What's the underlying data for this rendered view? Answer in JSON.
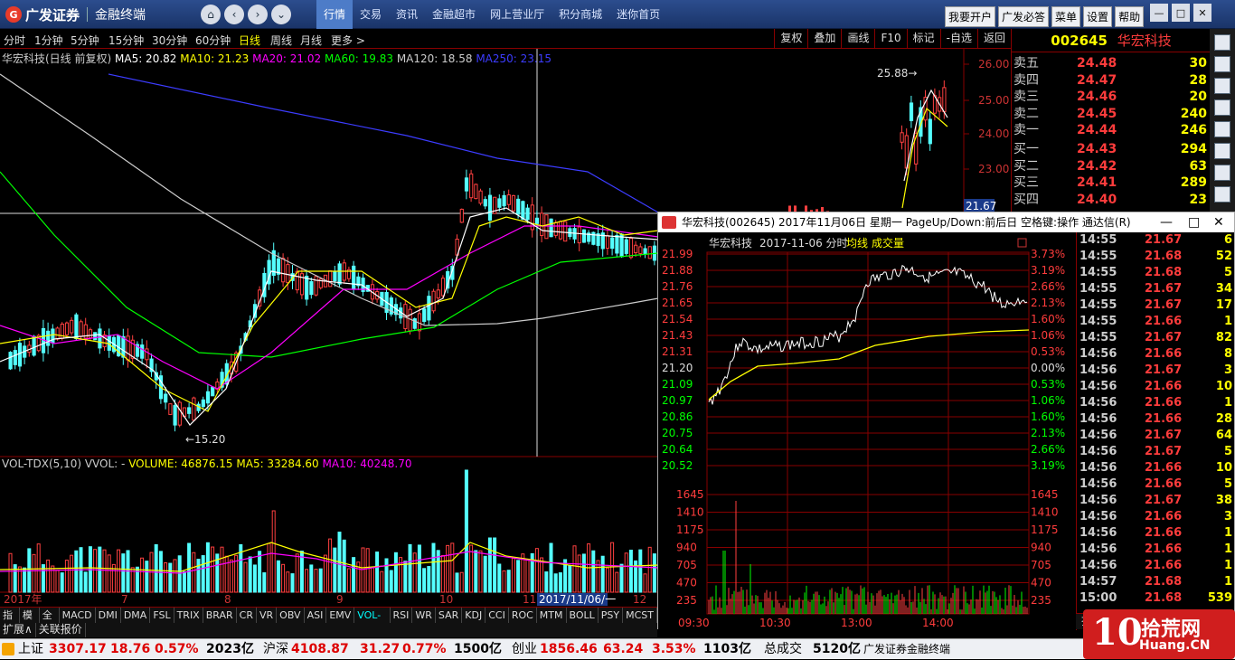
{
  "titlebar": {
    "logo_text": "广发证券",
    "logo_subtitle": "金融终端",
    "menu": [
      "行情",
      "交易",
      "资讯",
      "金融超市",
      "网上营业厅",
      "积分商城",
      "迷你首页"
    ],
    "active_menu": "行情",
    "right_buttons": [
      "我要开户",
      "广发必答",
      "菜单",
      "设置",
      "帮助"
    ]
  },
  "period_bar": {
    "periods": [
      "分时",
      "1分钟",
      "5分钟",
      "15分钟",
      "30分钟",
      "60分钟",
      "日线",
      "周线",
      "月线",
      "更多 >"
    ],
    "active": "日线",
    "tools": [
      "复权",
      "叠加",
      "画线",
      "F10",
      "标记",
      "-自选",
      "返回"
    ]
  },
  "ma_legend": {
    "prefix": "华宏科技(日线 前复权)",
    "items": [
      {
        "label": "MA5: 20.82",
        "color": "#ffffff"
      },
      {
        "label": "MA10: 21.23",
        "color": "#ffff00"
      },
      {
        "label": "MA20: 21.02",
        "color": "#ff00ff"
      },
      {
        "label": "MA60: 19.83",
        "color": "#00ff00"
      },
      {
        "label": "MA120: 18.58",
        "color": "#cccccc"
      },
      {
        "label": "MA250: 23.15",
        "color": "#3c3cff"
      }
    ]
  },
  "vol_legend": {
    "prefix": "VOL-TDX(5,10)  VVOL: -",
    "items": [
      {
        "label": "VOLUME: 46876.15",
        "color": "#ffff00"
      },
      {
        "label": "MA5: 33284.60",
        "color": "#ffff00"
      },
      {
        "label": "MA10: 40248.70",
        "color": "#ff00ff"
      }
    ]
  },
  "kline_axis": {
    "price_ticks": [
      "26.00",
      "25.00",
      "24.00",
      "23.00"
    ],
    "cursor_price": "21.67",
    "low_label": "15.20",
    "high_label": "25.88",
    "date_labels": [
      "2017年",
      "7",
      "8",
      "9",
      "10",
      "11",
      "2017/11/06/一",
      "12"
    ]
  },
  "quote": {
    "code": "002645",
    "name": "华宏科技",
    "rows": [
      {
        "label": "卖五",
        "price": "24.48",
        "vol": "30"
      },
      {
        "label": "卖四",
        "price": "24.47",
        "vol": "28"
      },
      {
        "label": "卖三",
        "price": "24.46",
        "vol": "20"
      },
      {
        "label": "卖二",
        "price": "24.45",
        "vol": "240"
      },
      {
        "label": "卖一",
        "price": "24.44",
        "vol": "246"
      },
      {
        "label": "买一",
        "price": "24.43",
        "vol": "294"
      },
      {
        "label": "买二",
        "price": "24.42",
        "vol": "63"
      },
      {
        "label": "买三",
        "price": "24.41",
        "vol": "289"
      },
      {
        "label": "买四",
        "price": "24.40",
        "vol": "23"
      }
    ]
  },
  "popup": {
    "title": "华宏科技(002645)  2017年11月06日  星期一  PageUp/Down:前后日  空格键:操作  通达信(R)",
    "chart_header": [
      "华宏科技",
      "2017-11-06 分时",
      "均线",
      "成交量"
    ],
    "price_ticks": [
      "21.99",
      "21.88",
      "21.76",
      "21.65",
      "21.54",
      "21.43",
      "21.31",
      "21.20",
      "21.09",
      "20.97",
      "20.86",
      "20.75",
      "20.64",
      "20.52"
    ],
    "pct_ticks": [
      "3.73%",
      "3.19%",
      "2.66%",
      "2.13%",
      "1.60%",
      "1.06%",
      "0.53%",
      "0.00%",
      "0.53%",
      "1.06%",
      "1.60%",
      "2.13%",
      "2.66%",
      "3.19%"
    ],
    "vol_ticks": [
      "1645",
      "1410",
      "1175",
      "940",
      "705",
      "470",
      "235"
    ],
    "time_labels": [
      "09:30",
      "10:30",
      "13:00",
      "14:00"
    ],
    "bottom_tab": "操作",
    "ticks": [
      {
        "t": "14:55",
        "p": "21.67",
        "v": "6"
      },
      {
        "t": "14:55",
        "p": "21.68",
        "v": "52"
      },
      {
        "t": "14:55",
        "p": "21.68",
        "v": "5"
      },
      {
        "t": "14:55",
        "p": "21.67",
        "v": "34"
      },
      {
        "t": "14:55",
        "p": "21.67",
        "v": "17"
      },
      {
        "t": "14:55",
        "p": "21.66",
        "v": "1"
      },
      {
        "t": "14:55",
        "p": "21.67",
        "v": "82"
      },
      {
        "t": "14:56",
        "p": "21.66",
        "v": "8"
      },
      {
        "t": "14:56",
        "p": "21.67",
        "v": "3"
      },
      {
        "t": "14:56",
        "p": "21.66",
        "v": "10"
      },
      {
        "t": "14:56",
        "p": "21.66",
        "v": "1"
      },
      {
        "t": "14:56",
        "p": "21.66",
        "v": "28"
      },
      {
        "t": "14:56",
        "p": "21.67",
        "v": "64"
      },
      {
        "t": "14:56",
        "p": "21.67",
        "v": "5"
      },
      {
        "t": "14:56",
        "p": "21.66",
        "v": "10"
      },
      {
        "t": "14:56",
        "p": "21.66",
        "v": "5"
      },
      {
        "t": "14:56",
        "p": "21.67",
        "v": "38"
      },
      {
        "t": "14:56",
        "p": "21.66",
        "v": "3"
      },
      {
        "t": "14:56",
        "p": "21.66",
        "v": "1"
      },
      {
        "t": "14:56",
        "p": "21.66",
        "v": "1"
      },
      {
        "t": "14:56",
        "p": "21.66",
        "v": "1"
      },
      {
        "t": "14:57",
        "p": "21.68",
        "v": "1"
      },
      {
        "t": "15:00",
        "p": "21.68",
        "v": "539"
      }
    ]
  },
  "indicator_tabs": [
    "指标",
    "模板",
    "全部",
    "MACD",
    "DMI",
    "DMA",
    "FSL",
    "TRIX",
    "BRAR",
    "CR",
    "VR",
    "OBV",
    "ASI",
    "EMV",
    "VOL-TDX",
    "RSI",
    "WR",
    "SAR",
    "KDJ",
    "CCI",
    "ROC",
    "MTM",
    "BOLL",
    "PSY",
    "MCST"
  ],
  "active_indicator": "VOL-TDX",
  "row2_tabs": [
    "扩展∧",
    "关联报价"
  ],
  "statusbar": {
    "sh_label": "上证",
    "sh_index": "3307.17",
    "sh_chg": "18.76",
    "sh_pct": "0.57%",
    "sh_amt": "2023亿",
    "hs_label": "沪深",
    "hs_index": "4108.87",
    "hs_chg": "31.27",
    "hs_pct": "0.77%",
    "hs_amt": "1500亿",
    "cy_label": "创业",
    "cy_index": "1856.46",
    "cy_chg": "63.24",
    "cy_pct": "3.53%",
    "cy_amt": "1103亿",
    "total_label": "总成交",
    "total_amt": "5120亿",
    "app": "广发证券金融终端"
  },
  "watermark": {
    "big": "10",
    "cn": "拾荒网",
    "url": "Huang.CN"
  }
}
